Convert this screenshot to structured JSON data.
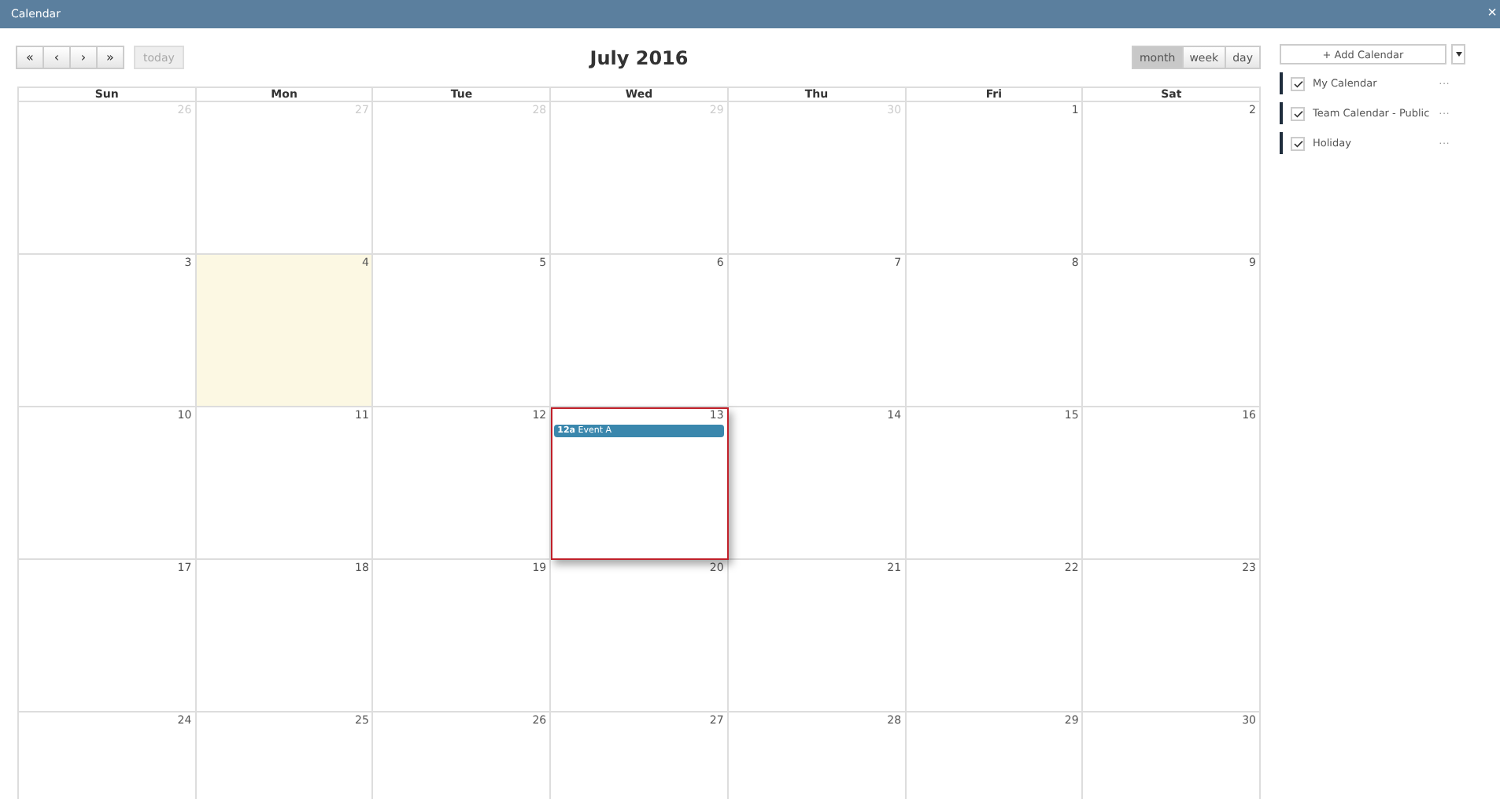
{
  "window": {
    "title": "Calendar",
    "close": "×"
  },
  "toolbar": {
    "nav": [
      "«",
      "‹",
      "›",
      "»"
    ],
    "today": {
      "label": "today",
      "disabled": true
    },
    "title": "July 2016",
    "views": [
      {
        "label": "month",
        "selected": true
      },
      {
        "label": "week",
        "selected": false
      },
      {
        "label": "day",
        "selected": false
      }
    ]
  },
  "weekdays": [
    "Sun",
    "Mon",
    "Tue",
    "Wed",
    "Thu",
    "Fri",
    "Sat"
  ],
  "weeks": [
    [
      {
        "day": "26",
        "other_month": true
      },
      {
        "day": "27",
        "other_month": true
      },
      {
        "day": "28",
        "other_month": true
      },
      {
        "day": "29",
        "other_month": true
      },
      {
        "day": "30",
        "other_month": true
      },
      {
        "day": "1",
        "other_month": false
      },
      {
        "day": "2",
        "other_month": false
      }
    ],
    [
      {
        "day": "3",
        "other_month": false
      },
      {
        "day": "4",
        "other_month": false,
        "today": true
      },
      {
        "day": "5",
        "other_month": false
      },
      {
        "day": "6",
        "other_month": false
      },
      {
        "day": "7",
        "other_month": false
      },
      {
        "day": "8",
        "other_month": false
      },
      {
        "day": "9",
        "other_month": false
      }
    ],
    [
      {
        "day": "10",
        "other_month": false
      },
      {
        "day": "11",
        "other_month": false
      },
      {
        "day": "12",
        "other_month": false
      },
      {
        "day": "13",
        "other_month": false,
        "selected": true,
        "events": [
          {
            "time": "12a",
            "title": "Event A",
            "color": "#3a87ad"
          }
        ]
      },
      {
        "day": "14",
        "other_month": false
      },
      {
        "day": "15",
        "other_month": false
      },
      {
        "day": "16",
        "other_month": false
      }
    ],
    [
      {
        "day": "17",
        "other_month": false
      },
      {
        "day": "18",
        "other_month": false
      },
      {
        "day": "19",
        "other_month": false
      },
      {
        "day": "20",
        "other_month": false
      },
      {
        "day": "21",
        "other_month": false
      },
      {
        "day": "22",
        "other_month": false
      },
      {
        "day": "23",
        "other_month": false
      }
    ],
    [
      {
        "day": "24",
        "other_month": false
      },
      {
        "day": "25",
        "other_month": false
      },
      {
        "day": "26",
        "other_month": false
      },
      {
        "day": "27",
        "other_month": false
      },
      {
        "day": "28",
        "other_month": false
      },
      {
        "day": "29",
        "other_month": false
      },
      {
        "day": "30",
        "other_month": false
      }
    ]
  ],
  "sidebar": {
    "add_button": "+ Add Calendar",
    "calendars": [
      {
        "name": "My Calendar",
        "checked": true,
        "color": "#1f2d3d",
        "menu": "···"
      },
      {
        "name": "Team Calendar - Public",
        "checked": true,
        "color": "#1f2d3d",
        "menu": "···"
      },
      {
        "name": "Holiday",
        "checked": true,
        "color": "#1f2d3d",
        "menu": "···"
      }
    ]
  }
}
